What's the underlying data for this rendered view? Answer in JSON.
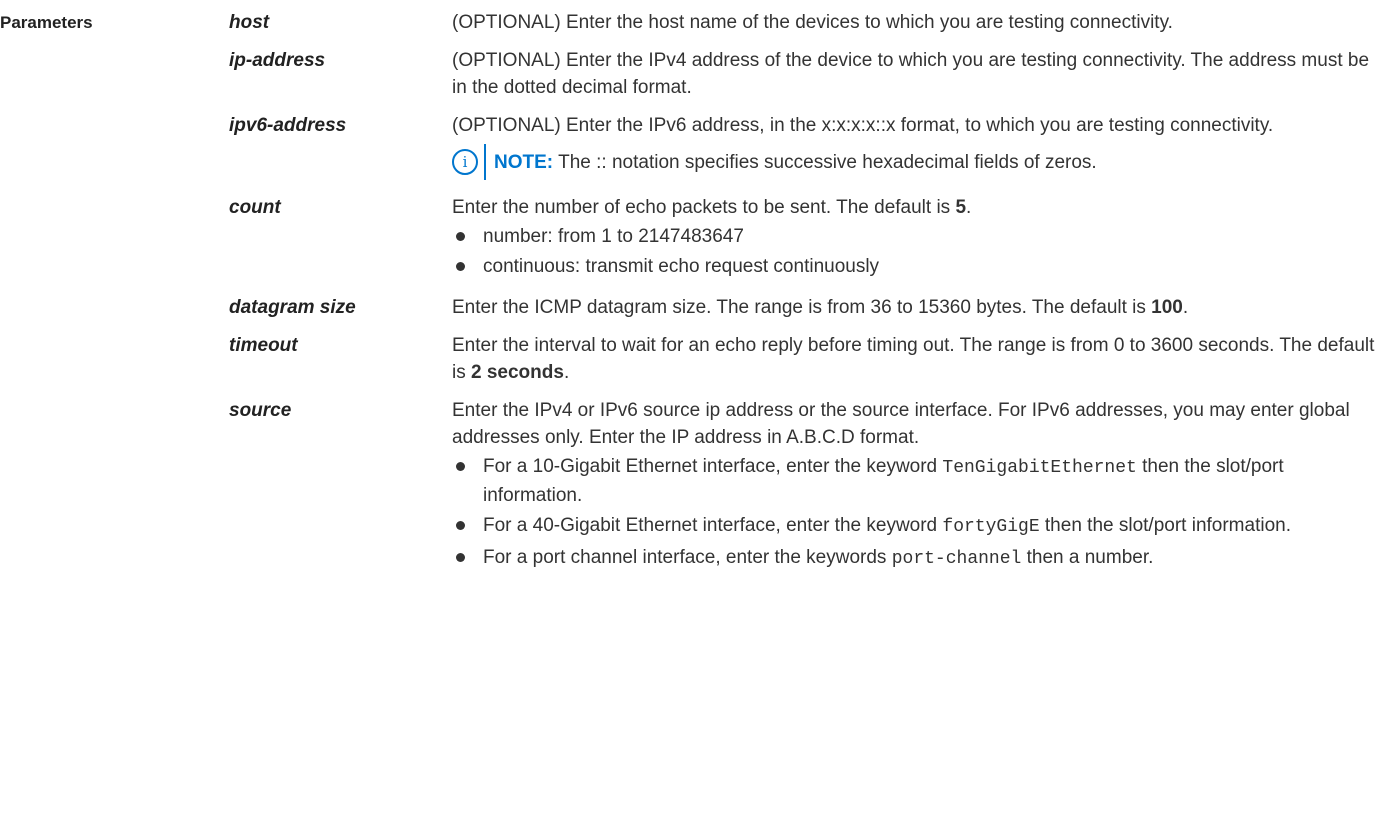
{
  "section_label": "Parameters",
  "params": [
    {
      "term": "host",
      "desc": "(OPTIONAL) Enter the host name of the devices to which you are testing connectivity."
    },
    {
      "term": "ip-address",
      "desc": "(OPTIONAL) Enter the IPv4 address of the device to which you are testing connectivity. The address must be in the dotted decimal format."
    },
    {
      "term": "ipv6-address",
      "desc": "(OPTIONAL) Enter the IPv6 address, in the x:x:x:x::x format, to which you are testing connectivity.",
      "note_label": "NOTE:",
      "note_text": "The :: notation specifies successive hexadecimal fields of zeros.",
      "note_icon": "info-icon"
    },
    {
      "term": "count",
      "desc_pre": "Enter the number of echo packets to be sent. The default is ",
      "desc_bold": "5",
      "desc_post": ".",
      "bullets": [
        "number: from 1 to 2147483647",
        "continuous: transmit echo request continuously"
      ]
    },
    {
      "term": "datagram size",
      "desc_pre": "Enter the ICMP datagram size. The range is from 36 to 15360 bytes. The default is ",
      "desc_bold": "100",
      "desc_post": "."
    },
    {
      "term": "timeout",
      "desc_pre": "Enter the interval to wait for an echo reply before timing out. The range is from 0 to 3600 seconds. The default is ",
      "desc_bold": "2 seconds",
      "desc_post": "."
    },
    {
      "term": "source",
      "desc": "Enter the IPv4 or IPv6 source ip address or the source interface. For IPv6 addresses, you may enter global addresses only. Enter the IP address in A.B.C.D format.",
      "bullets": [
        {
          "pre": "For a 10-Gigabit Ethernet interface, enter the keyword ",
          "code": "TenGigabitEthernet",
          "post": " then the slot/port information."
        },
        {
          "pre": "For a 40-Gigabit Ethernet interface, enter the keyword ",
          "code": "fortyGigE",
          "post": " then the slot/port information."
        },
        {
          "pre": "For a port channel interface, enter the keywords ",
          "code": "port-channel",
          "post": " then a number."
        }
      ]
    }
  ],
  "colors": {
    "accent": "#0076ce",
    "text": "#333333"
  }
}
